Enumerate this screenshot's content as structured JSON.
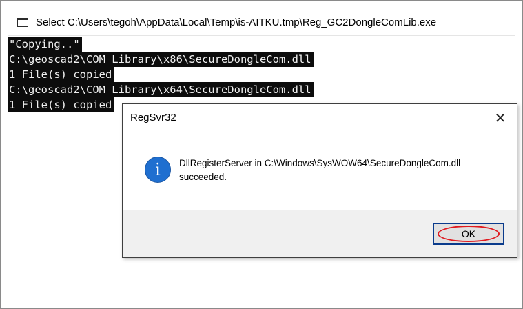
{
  "console": {
    "title": "Select C:\\Users\\tegoh\\AppData\\Local\\Temp\\is-AITKU.tmp\\Reg_GC2DongleComLib.exe",
    "icon": "console-window-icon",
    "lines": [
      "\"Copying..\"",
      "C:\\geoscad2\\COM Library\\x86\\SecureDongleCom.dll",
      "1 File(s) copied",
      "C:\\geoscad2\\COM Library\\x64\\SecureDongleCom.dll",
      "1 File(s) copied"
    ]
  },
  "dialog": {
    "title": "RegSvr32",
    "close_label": "✕",
    "icon": "info-icon",
    "icon_glyph": "i",
    "message_line1": "DllRegisterServer in C:\\Windows\\SysWOW64\\SecureDongleCom.dll",
    "message_line2": "succeeded.",
    "ok_label": "OK",
    "highlight_color": "#e0191f"
  }
}
